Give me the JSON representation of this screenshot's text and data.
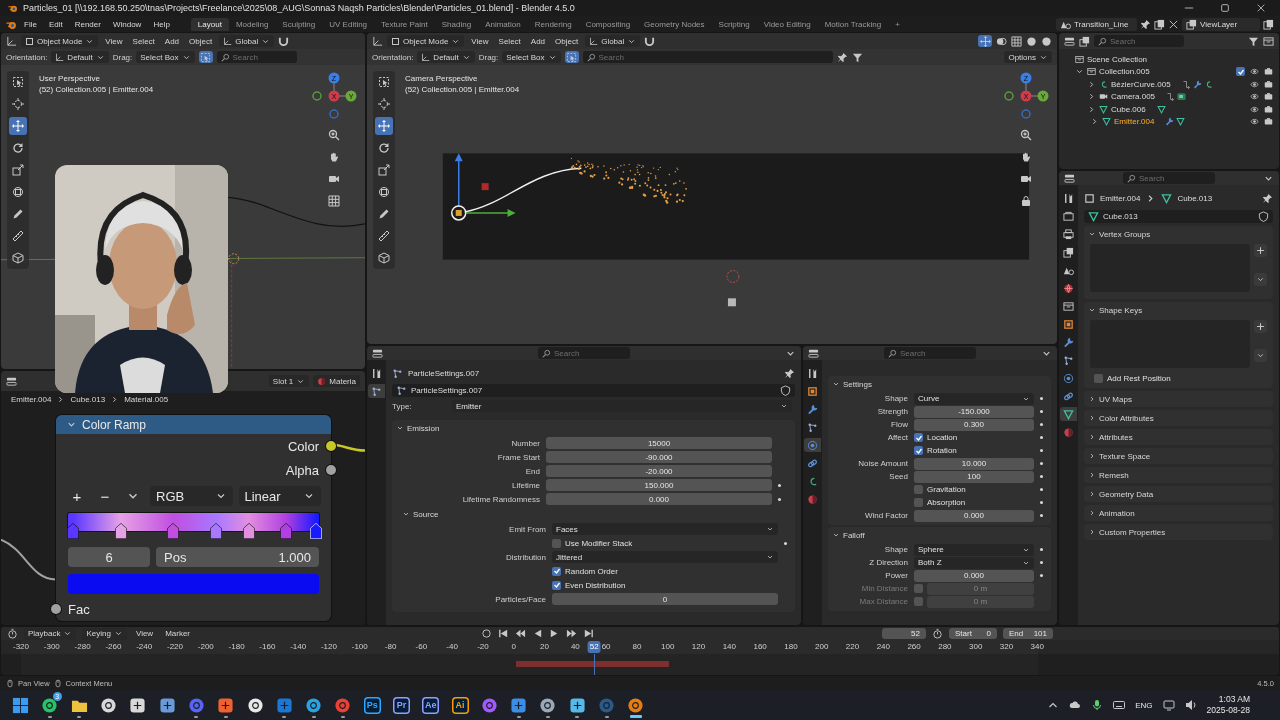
{
  "window": {
    "title": "Particles_01 [\\\\192.168.50.250\\tnas\\Projects\\Freelance\\2025\\08_AUG\\Sonna3 Naqsh Particles\\Blender\\Particles_01.blend] - Blender 4.5.0"
  },
  "menu": [
    "File",
    "Edit",
    "Render",
    "Window",
    "Help"
  ],
  "workspaces": [
    {
      "label": "Layout",
      "selected": true
    },
    {
      "label": "Modeling",
      "selected": false
    },
    {
      "label": "Sculpting",
      "selected": false
    },
    {
      "label": "UV Editing",
      "selected": false
    },
    {
      "label": "Texture Paint",
      "selected": false
    },
    {
      "label": "Shading",
      "selected": false
    },
    {
      "label": "Animation",
      "selected": false
    },
    {
      "label": "Rendering",
      "selected": false
    },
    {
      "label": "Compositing",
      "selected": false
    },
    {
      "label": "Geometry Nodes",
      "selected": false
    },
    {
      "label": "Scripting",
      "selected": false
    },
    {
      "label": "Video Editing",
      "selected": false
    },
    {
      "label": "Motion Tracking",
      "selected": false
    }
  ],
  "add_workspace": "+",
  "scene": {
    "name": "Transition_Line"
  },
  "view_layer": {
    "name": "ViewLayer"
  },
  "viewports": [
    {
      "kind": "user",
      "mode": "Object Mode",
      "menus": [
        "View",
        "Select",
        "Add",
        "Object"
      ],
      "transform": "Global",
      "orientation_label": "Orientation:",
      "orientation": "Default",
      "drag_label": "Drag:",
      "drag": "Select Box",
      "placeholder": "Search",
      "view_name": "User Perspective",
      "info": "(52) Collection.005 | Emitter.004",
      "gizmo": [
        "X",
        "Y",
        "Z"
      ],
      "tools": [
        {
          "kind": "select",
          "selected": false
        },
        {
          "kind": "cursor",
          "selected": false
        },
        {
          "kind": "move",
          "selected": true
        },
        {
          "kind": "rotate",
          "selected": false
        },
        {
          "kind": "scale",
          "selected": false
        },
        {
          "kind": "transform",
          "selected": false
        },
        {
          "kind": "annotate",
          "selected": false
        },
        {
          "kind": "measure",
          "selected": false
        },
        {
          "kind": "add-cube",
          "selected": false
        }
      ],
      "nav": [
        {
          "kind": "zoom"
        },
        {
          "kind": "pan"
        },
        {
          "kind": "camera"
        },
        {
          "kind": "grid"
        }
      ]
    },
    {
      "kind": "camera",
      "mode": "Object Mode",
      "menus": [
        "View",
        "Select",
        "Add",
        "Object"
      ],
      "transform": "Global",
      "orientation_label": "Orientation:",
      "orientation": "Default",
      "drag_label": "Drag:",
      "drag": "Select Box",
      "placeholder": "Search",
      "options": "Options",
      "view_name": "Camera Perspective",
      "info": "(52) Collection.005 | Emitter.004",
      "gizmo": [
        "X",
        "Y",
        "Z"
      ],
      "tools": [
        {
          "kind": "select",
          "selected": false
        },
        {
          "kind": "cursor",
          "selected": false
        },
        {
          "kind": "move",
          "selected": true
        },
        {
          "kind": "rotate",
          "selected": false
        },
        {
          "kind": "scale",
          "selected": false
        },
        {
          "kind": "transform",
          "selected": false
        },
        {
          "kind": "annotate",
          "selected": false
        },
        {
          "kind": "measure",
          "selected": false
        },
        {
          "kind": "add-cube",
          "selected": false
        }
      ],
      "nav": [
        {
          "kind": "zoom"
        },
        {
          "kind": "pan"
        },
        {
          "kind": "camera"
        },
        {
          "kind": "lock"
        }
      ]
    }
  ],
  "node_editor": {
    "slot": "Slot 1",
    "material": "Materia",
    "breadcrumb": [
      "Emitter.004",
      "Cube.013",
      "Material.005"
    ],
    "node": {
      "title": "Color Ramp",
      "outputs": [
        {
          "label": "Color",
          "color": "#c7c729"
        },
        {
          "label": "Alpha",
          "color": "#a1a1a1"
        }
      ],
      "buttons": [
        "+",
        "−"
      ],
      "color_mode": "RGB",
      "interpolation": "Linear",
      "stops": [
        {
          "level": 0.02,
          "color": "#5a36ff",
          "selected": false
        },
        {
          "level": 0.21,
          "color": "#e6a2e6",
          "selected": false
        },
        {
          "level": 0.42,
          "color": "#c04fe0",
          "selected": false
        },
        {
          "level": 0.59,
          "color": "#a878ff",
          "selected": false
        },
        {
          "level": 0.72,
          "color": "#e28fe0",
          "selected": false
        },
        {
          "level": 0.87,
          "color": "#b040e0",
          "selected": false
        },
        {
          "level": 0.99,
          "color": "#1a1aff",
          "selected": true
        }
      ],
      "stop_index": "6",
      "pos_label": "Pos",
      "pos_value": "1.000",
      "swatch": {
        "color": "#0b0bf2"
      },
      "inputs": [
        {
          "label": "Fac",
          "color": "#a1a1a1"
        }
      ]
    }
  },
  "particle_props": {
    "placeholder": "Search",
    "title": "ParticleSettings.007",
    "datablock": "ParticleSettings.007",
    "type_label": "Type:",
    "type": "Emitter",
    "tabs": [
      {
        "kind": "tool",
        "selected": false
      },
      {
        "kind": "particles",
        "selected": true
      }
    ],
    "panels": [
      {
        "title": "Emission",
        "expanded": true,
        "rows": [
          {
            "kind": "number",
            "label": "Number",
            "value": "15000",
            "keyable": false
          },
          {
            "kind": "number",
            "label": "Frame Start",
            "value": "-90.000",
            "keyable": false
          },
          {
            "kind": "number",
            "label": "End",
            "value": "-20.000",
            "keyable": false
          },
          {
            "kind": "number",
            "label": "Lifetime",
            "value": "150.000",
            "keyable": true
          },
          {
            "kind": "number",
            "label": "Lifetime Randomness",
            "value": "0.000",
            "keyable": true
          }
        ],
        "subpanels": [
          {
            "title": "Source",
            "expanded": true,
            "rows": [
              {
                "kind": "dropdown",
                "label": "Emit From",
                "value": "Faces",
                "keyable": false
              },
              {
                "kind": "check",
                "text": "Use Modifier Stack",
                "checked": false,
                "keyable": true
              },
              {
                "kind": "dropdown",
                "label": "Distribution",
                "value": "Jittered",
                "keyable": false
              },
              {
                "kind": "check",
                "text": "Random Order",
                "checked": true,
                "keyable": false
              },
              {
                "kind": "check",
                "text": "Even Distribution",
                "checked": true,
                "keyable": false
              },
              {
                "kind": "number",
                "label": "Particles/Face",
                "value": "0",
                "keyable": false
              }
            ]
          }
        ]
      }
    ]
  },
  "force_props": {
    "placeholder": "Search",
    "tabs": [
      {
        "kind": "tool",
        "selected": false
      },
      {
        "kind": "object",
        "selected": false
      },
      {
        "kind": "modifier",
        "selected": false
      },
      {
        "kind": "particles",
        "selected": false
      },
      {
        "kind": "physics",
        "selected": true
      },
      {
        "kind": "constraints",
        "selected": false
      },
      {
        "kind": "data_curve",
        "selected": false
      },
      {
        "kind": "material",
        "selected": false
      }
    ],
    "panels": [
      {
        "title": "Settings",
        "expanded": true,
        "rows": [
          {
            "kind": "dropdown",
            "label": "Shape",
            "value": "Curve",
            "keyable": true
          },
          {
            "kind": "number",
            "label": "Strength",
            "value": "-150.000",
            "keyable": true
          },
          {
            "kind": "number",
            "label": "Flow",
            "value": "0.300",
            "keyable": true
          },
          {
            "kind": "check",
            "label": "Affect",
            "text": "Location",
            "checked": true,
            "keyable": true
          },
          {
            "kind": "check",
            "text": "Rotation",
            "checked": true,
            "keyable": true
          },
          {
            "kind": "number",
            "label": "Noise Amount",
            "value": "10.000",
            "keyable": true
          },
          {
            "kind": "number",
            "label": "Seed",
            "value": "100",
            "keyable": true
          },
          {
            "kind": "check",
            "text": "Gravitation",
            "checked": false,
            "keyable": true
          },
          {
            "kind": "check",
            "text": "Absorption",
            "checked": false,
            "keyable": true
          },
          {
            "kind": "number",
            "label": "Wind Factor",
            "value": "0.000",
            "keyable": true
          }
        ]
      },
      {
        "title": "Falloff",
        "expanded": true,
        "rows": [
          {
            "kind": "dropdown",
            "label": "Shape",
            "value": "Sphere",
            "keyable": true
          },
          {
            "kind": "dropdown",
            "label": "Z Direction",
            "value": "Both Z",
            "keyable": true
          },
          {
            "kind": "number",
            "label": "Power",
            "value": "0.000",
            "keyable": true
          },
          {
            "kind": "check_number",
            "label": "Min Distance",
            "checked": false,
            "value": "0 m",
            "disabled": true,
            "keyable": false
          },
          {
            "kind": "check_number",
            "label": "Max Distance",
            "checked": false,
            "value": "0 m",
            "disabled": true,
            "keyable": false
          }
        ]
      }
    ]
  },
  "outliner": {
    "placeholder": "Search",
    "tree": [
      {
        "kind": "scene",
        "label": "Scene Collection",
        "selected": false,
        "children": [
          {
            "kind": "collection",
            "label": "Collection.005",
            "expanded": true,
            "checked": true,
            "selected": false,
            "children": [
              {
                "kind": "curve",
                "label": "BézierCurve.005",
                "expanded": false,
                "selected": false,
                "extras": [
                  {
                    "kind": "constraint"
                  },
                  {
                    "kind": "modifier"
                  },
                  {
                    "kind": "data_curve"
                  }
                ]
              },
              {
                "kind": "camera",
                "label": "Camera.005",
                "expanded": false,
                "selected": false,
                "extras": [
                  {
                    "kind": "constraint"
                  },
                  {
                    "kind": "data_camera"
                  }
                ]
              },
              {
                "kind": "mesh",
                "label": "Cube.006",
                "expanded": false,
                "selected": false,
                "extras": [
                  {
                    "kind": "data_mesh"
                  }
                ]
              },
              {
                "kind": "mesh",
                "label": "Emitter.004",
                "expanded": false,
                "selected": true,
                "extras": [
                  {
                    "kind": "modifier"
                  },
                  {
                    "kind": "data_mesh"
                  }
                ]
              }
            ]
          }
        ]
      }
    ]
  },
  "data_props": {
    "placeholder": "Search",
    "breadcrumb": [
      "Emitter.004",
      "Cube.013"
    ],
    "datablock": "Cube.013",
    "tabs": [
      {
        "kind": "tool",
        "selected": false
      },
      {
        "kind": "render",
        "selected": false
      },
      {
        "kind": "output",
        "selected": false
      },
      {
        "kind": "view_layer",
        "selected": false
      },
      {
        "kind": "scene",
        "selected": false
      },
      {
        "kind": "world",
        "selected": false
      },
      {
        "kind": "collection",
        "selected": false
      },
      {
        "kind": "object",
        "selected": false
      },
      {
        "kind": "modifier",
        "selected": false
      },
      {
        "kind": "particles",
        "selected": false
      },
      {
        "kind": "physics",
        "selected": false
      },
      {
        "kind": "constraints",
        "selected": false
      },
      {
        "kind": "data_mesh",
        "selected": true
      },
      {
        "kind": "material",
        "selected": false
      }
    ],
    "panels": [
      {
        "title": "Vertex Groups",
        "expanded": true,
        "kind": "list"
      },
      {
        "title": "Shape Keys",
        "expanded": true,
        "kind": "list",
        "option": {
          "text": "Add Rest Position",
          "checked": false
        }
      },
      {
        "title": "UV Maps",
        "expanded": false
      },
      {
        "title": "Color Attributes",
        "expanded": false
      },
      {
        "title": "Attributes",
        "expanded": false
      },
      {
        "title": "Texture Space",
        "expanded": false
      },
      {
        "title": "Remesh",
        "expanded": false
      },
      {
        "title": "Geometry Data",
        "expanded": false
      },
      {
        "title": "Animation",
        "expanded": false
      },
      {
        "title": "Custom Properties",
        "expanded": false
      }
    ]
  },
  "timeline": {
    "menus": [
      {
        "label": "Playback",
        "dropdown": true
      },
      {
        "label": "Keying",
        "dropdown": true
      },
      {
        "label": "View",
        "dropdown": false
      },
      {
        "label": "Marker",
        "dropdown": false
      }
    ],
    "frame": "52",
    "start_label": "Start",
    "start": "0",
    "end_label": "End",
    "end": "101",
    "ruler": [
      "-320",
      "-300",
      "-280",
      "-260",
      "-240",
      "-220",
      "-200",
      "-180",
      "-160",
      "-140",
      "-120",
      "-100",
      "-80",
      "-60",
      "-40",
      "-20",
      "0",
      "20",
      "40",
      "60",
      "80",
      "100",
      "120",
      "140",
      "160",
      "180",
      "200",
      "220",
      "240",
      "260",
      "280",
      "300",
      "320",
      "340"
    ],
    "playhead": {
      "frame": "52",
      "level": 0.5636
    }
  },
  "status_bar": {
    "items": [
      {
        "kind": "mouse",
        "text": "Pan View"
      },
      {
        "kind": "mouse",
        "text": "Context Menu"
      }
    ],
    "version": "4.5.0"
  },
  "taskbar": {
    "apps": [
      {
        "kind": "windows",
        "color": "#3b9bf0",
        "running": false,
        "selected": false
      },
      {
        "kind": "round",
        "color": "#25c464",
        "running": true,
        "selected": false,
        "badge": "3"
      },
      {
        "kind": "folder",
        "color": "#f0c040",
        "running": true,
        "selected": false
      },
      {
        "kind": "round",
        "color": "#d8d8d8",
        "running": false,
        "selected": false
      },
      {
        "kind": "square",
        "color": "#d8d8d8",
        "running": false,
        "selected": false
      },
      {
        "kind": "square",
        "color": "#6a9ad8",
        "running": false,
        "selected": false
      },
      {
        "kind": "round",
        "color": "#5865f2",
        "running": true,
        "selected": false
      },
      {
        "kind": "square",
        "color": "#f06030",
        "running": true,
        "selected": false
      },
      {
        "kind": "round",
        "color": "#e8e8e8",
        "running": false,
        "selected": false
      },
      {
        "kind": "square",
        "color": "#1a78d4",
        "running": true,
        "selected": false
      },
      {
        "kind": "round",
        "color": "#2aa3e0",
        "running": true,
        "selected": false
      },
      {
        "kind": "round",
        "color": "#e94235",
        "running": true,
        "selected": false
      },
      {
        "kind": "text",
        "label": "Ps",
        "color": "#31a8ff",
        "running": false,
        "selected": false
      },
      {
        "kind": "text",
        "label": "Pr",
        "color": "#9999ff",
        "running": false,
        "selected": false
      },
      {
        "kind": "text",
        "label": "Ae",
        "color": "#9999ff",
        "running": false,
        "selected": false
      },
      {
        "kind": "text",
        "label": "Ai",
        "color": "#ff9a00",
        "running": false,
        "selected": false
      },
      {
        "kind": "round",
        "color": "#a259ff",
        "running": false,
        "selected": false
      },
      {
        "kind": "square",
        "color": "#3a8ee6",
        "running": true,
        "selected": false
      },
      {
        "kind": "round",
        "color": "#9aa8b8",
        "running": true,
        "selected": false
      },
      {
        "kind": "square",
        "color": "#58b8e8",
        "running": true,
        "selected": false
      },
      {
        "kind": "round",
        "color": "#2a5a8a",
        "running": true,
        "selected": false
      },
      {
        "kind": "round",
        "color": "#e87d0d",
        "running": true,
        "selected": true
      }
    ],
    "language": "ENG",
    "time": "1:03 AM",
    "date": "2025-08-28"
  }
}
